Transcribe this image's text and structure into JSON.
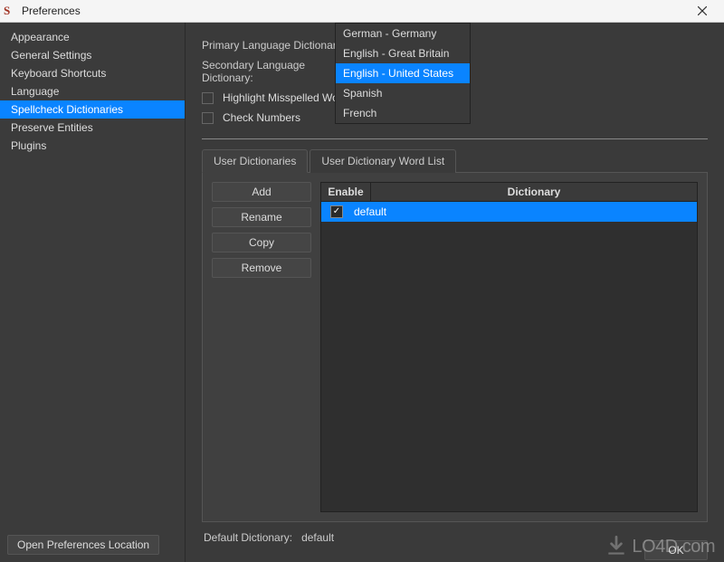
{
  "window": {
    "title": "Preferences",
    "icon_char": "S"
  },
  "sidebar": {
    "items": [
      {
        "label": "Appearance"
      },
      {
        "label": "General Settings"
      },
      {
        "label": "Keyboard Shortcuts"
      },
      {
        "label": "Language"
      },
      {
        "label": "Spellcheck Dictionaries"
      },
      {
        "label": "Preserve Entities"
      },
      {
        "label": "Plugins"
      }
    ],
    "selected_index": 4,
    "footer_button": "Open Preferences Location"
  },
  "main": {
    "primary_label": "Primary Language Dictionary:",
    "secondary_label": "Secondary Language Dictionary:",
    "highlight_label": "Highlight Misspelled Words",
    "check_numbers_label": "Check Numbers",
    "tabs": [
      {
        "label": "User Dictionaries"
      },
      {
        "label": "User Dictionary Word List"
      }
    ],
    "active_tab": 0,
    "buttons": {
      "add": "Add",
      "rename": "Rename",
      "copy": "Copy",
      "remove": "Remove"
    },
    "table": {
      "col_enable": "Enable",
      "col_dict": "Dictionary",
      "rows": [
        {
          "enabled": true,
          "name": "default"
        }
      ]
    },
    "default_label": "Default Dictionary:",
    "default_value": "default",
    "ok_button": "OK"
  },
  "dropdown": {
    "items": [
      "German - Germany",
      "English - Great Britain",
      "English - United States",
      "Spanish",
      "French"
    ],
    "selected_index": 2
  },
  "watermark": {
    "text": "LO4D.com"
  }
}
